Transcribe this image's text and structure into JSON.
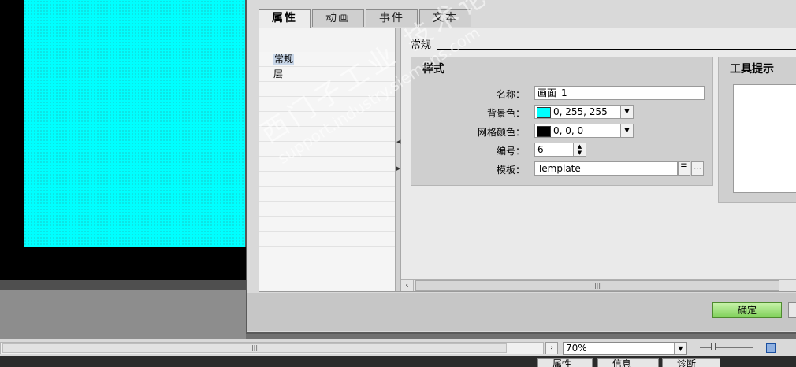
{
  "dialog": {
    "tabs": [
      {
        "label": "属性",
        "active": true
      },
      {
        "label": "动画",
        "active": false
      },
      {
        "label": "事件",
        "active": false
      },
      {
        "label": "文本",
        "active": false
      }
    ],
    "nav": [
      {
        "label": "常规",
        "selected": true
      },
      {
        "label": "层",
        "selected": false
      }
    ],
    "section_label": "常规",
    "style_group": {
      "title": "样式",
      "fields": {
        "name": {
          "label": "名称：",
          "value": "画面_1"
        },
        "bg_color": {
          "label": "背景色：",
          "value": "0, 255, 255",
          "swatch": "#00ffff"
        },
        "grid_color": {
          "label": "网格颜色：",
          "value": "0, 0, 0",
          "swatch": "#000000"
        },
        "number": {
          "label": "编号：",
          "value": "6"
        },
        "template": {
          "label": "模板：",
          "value": "Template"
        }
      }
    },
    "tooltip_group": {
      "title": "工具提示"
    },
    "ok_label": "确定"
  },
  "statusbar": {
    "zoom": "70%"
  },
  "taskbar": {
    "items": [
      "属性",
      "信息",
      "诊断"
    ]
  },
  "watermark": {
    "line1": "西门子工业 技术论坛",
    "line2": "support.industry.siemens.com"
  }
}
